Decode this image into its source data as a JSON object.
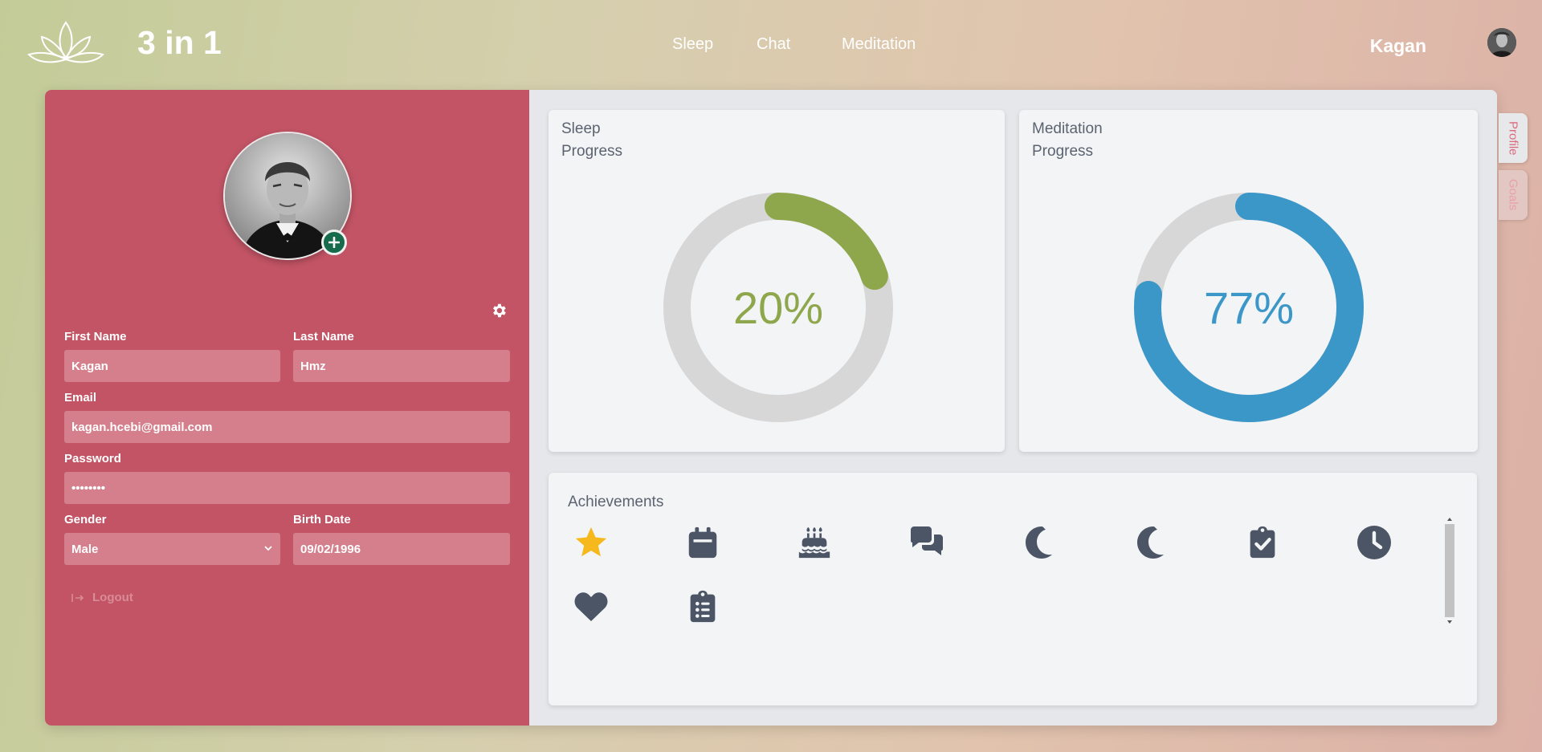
{
  "header": {
    "brand": "3 in 1",
    "nav": [
      "Sleep",
      "Chat",
      "Meditation"
    ],
    "user_name": "Kagan"
  },
  "profile": {
    "first_name_label": "First Name",
    "first_name": "Kagan",
    "last_name_label": "Last Name",
    "last_name": "Hmz",
    "email_label": "Email",
    "email": "kagan.hcebi@gmail.com",
    "password_label": "Password",
    "password": "••••••••",
    "gender_label": "Gender",
    "gender": "Male",
    "birth_label": "Birth Date",
    "birth_date": "09/02/1996",
    "logout_label": "Logout"
  },
  "sleep_card": {
    "title_line1": "Sleep",
    "title_line2": "Progress",
    "percent": 20,
    "percent_label": "20%",
    "color": "#8fa74c"
  },
  "meditation_card": {
    "title_line1": "Meditation",
    "title_line2": "Progress",
    "percent": 77,
    "percent_label": "77%",
    "color": "#3c97c9"
  },
  "achievements": {
    "title": "Achievements",
    "icons": [
      "star-icon",
      "calendar-icon",
      "birthday-cake-icon",
      "comments-icon",
      "moon-icon",
      "moon-icon",
      "clipboard-check-icon",
      "clock-icon",
      "heart-icon",
      "clipboard-list-icon"
    ]
  },
  "side_tabs": [
    "Profile",
    "Goals"
  ],
  "colors": {
    "left_panel": "#c25465",
    "field_bg": "#d47f8b",
    "icon_dark": "#4b5565",
    "star": "#f5b91d",
    "track": "#d7d7d7"
  }
}
